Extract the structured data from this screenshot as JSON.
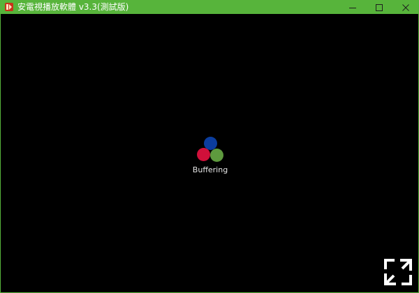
{
  "window": {
    "title": "安電視播放軟體 v3.3(測試版)",
    "title_bar_color": "#57b43b"
  },
  "title_bar_buttons": {
    "minimize_icon": "minimize-icon",
    "maximize_icon": "maximize-icon",
    "close_icon": "close-icon"
  },
  "player": {
    "background": "#000000",
    "status_text": "Buffering",
    "spinner_colors": [
      "#0b3d9e",
      "#d0103a",
      "#5e9a3e"
    ],
    "fullscreen_icon": "fullscreen-icon"
  }
}
